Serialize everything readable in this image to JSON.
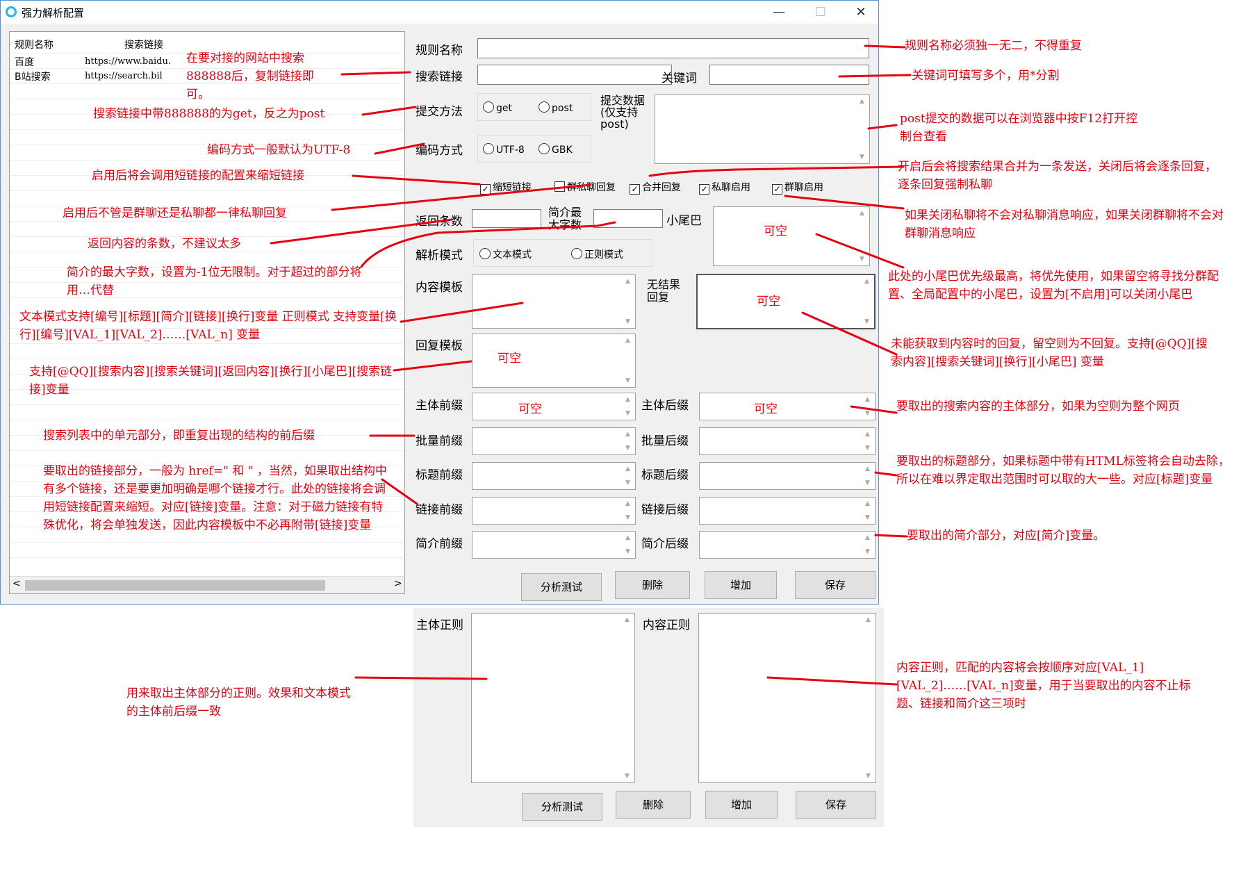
{
  "window": {
    "title": "强力解析配置",
    "minimize": "—",
    "maximize": "☐",
    "close": "✕"
  },
  "rules_list": {
    "headers": [
      "规则名称",
      "搜索链接"
    ],
    "rows": [
      {
        "name": "百度",
        "link": "https://www.baidu."
      },
      {
        "name": "B站搜索",
        "link": "https://search.bil"
      }
    ],
    "scroll_left": "<",
    "scroll_right": ">"
  },
  "form": {
    "rule_name_label": "规则名称",
    "search_link_label": "搜索链接",
    "keyword_label": "关键词",
    "submit_method_label": "提交方法",
    "submit_get": "get",
    "submit_post": "post",
    "submit_data_label": "提交数据(仅支持post)",
    "encoding_label": "编码方式",
    "enc_utf8": "UTF-8",
    "enc_gbk": "GBK",
    "checkboxes": [
      {
        "label": "缩短链接",
        "checked": true
      },
      {
        "label": "群私聊回复",
        "checked": false
      },
      {
        "label": "合并回复",
        "checked": true
      },
      {
        "label": "私聊启用",
        "checked": true
      },
      {
        "label": "群聊启用",
        "checked": true
      }
    ],
    "return_count_label": "返回条数",
    "summary_max_label": "简介最大字数",
    "tail_label": "小尾巴",
    "tail_placeholder": "可空",
    "parse_mode_label": "解析模式",
    "mode_text": "文本模式",
    "mode_regex": "正则模式",
    "content_tpl_label": "内容模板",
    "no_result_label": "无结果回复",
    "no_result_placeholder": "可空",
    "reply_tpl_label": "回复模板",
    "reply_tpl_placeholder": "可空",
    "body_prefix_label": "主体前缀",
    "body_prefix_placeholder": "可空",
    "body_suffix_label": "主体后缀",
    "body_suffix_placeholder": "可空",
    "batch_prefix_label": "批量前缀",
    "batch_suffix_label": "批量后缀",
    "title_prefix_label": "标题前缀",
    "title_suffix_label": "标题后缀",
    "link_prefix_label": "链接前缀",
    "link_suffix_label": "链接后缀",
    "summary_prefix_label": "简介前缀",
    "summary_suffix_label": "简介后缀",
    "body_regex_label": "主体正则",
    "content_regex_label": "内容正则"
  },
  "buttons": {
    "analyze": "分析测试",
    "delete": "删除",
    "add": "增加",
    "save": "保存"
  },
  "annotations": {
    "a1": "在要对接的网站中搜索888888后，复制链接即可。",
    "a2": "搜索链接中带888888的为get，反之为post",
    "a3": "编码方式一般默认为UTF-8",
    "a4": "启用后将会调用短链接的配置来缩短链接",
    "a5": "启用后不管是群聊还是私聊都一律私聊回复",
    "a6": "返回内容的条数，不建议太多",
    "a7": "简介的最大字数，设置为-1位无限制。对于超过的部分将用…代替",
    "a8": "文本模式支持[编号][标题][简介][链接][换行]变量   正则模式 支持变量[换行][编号][VAL_1][VAL_2]……[VAL_n] 变量",
    "a9": "支持[@QQ][搜索内容][搜索关键词][返回内容][换行][小尾巴][搜索链接]变量",
    "a10": "搜索列表中的单元部分，即重复出现的结构的前后缀",
    "a11": "要取出的链接部分，一般为 href=\" 和 \" ，当然，如果取出结构中有多个链接，还是要更加明确是哪个链接才行。此处的链接将会调用短链接配置来缩短。对应[链接]变量。注意：对于磁力链接有特殊优化，将会单独发送，因此内容模板中不必再附带[链接]变量",
    "a12": "用来取出主体部分的正则。效果和文本模式的主体前后缀一致",
    "r1": "规则名称必须独一无二，不得重复",
    "r2": "关键词可填写多个，用*分割",
    "r3": "post提交的数据可以在浏览器中按F12打开控制台查看",
    "r4": "开启后会将搜索结果合并为一条发送，关闭后将会逐条回复，逐条回复强制私聊",
    "r5": "如果关闭私聊将不会对私聊消息响应，如果关闭群聊将不会对群聊消息响应",
    "r6": "此处的小尾巴优先级最高，将优先使用，如果留空将寻找分群配置、全局配置中的小尾巴，设置为[不启用]可以关闭小尾巴",
    "r7": "未能获取到内容时的回复，留空则为不回复。支持[@QQ][搜索内容][搜索关键词][换行][小尾巴] 变量",
    "r8": "要取出的搜索内容的主体部分，如果为空则为整个网页",
    "r9": "要取出的标题部分，如果标题中带有HTML标签将会自动去除，所以在难以界定取出范围时可以取的大一些。对应[标题]变量",
    "r10": "要取出的简介部分，对应[简介]变量。",
    "r11": "内容正则，匹配的内容将会按顺序对应[VAL_1][VAL_2]……[VAL_n]变量，用于当要取出的内容不止标题、链接和简介这三项时"
  },
  "colors": {
    "annotation": "#e60012",
    "window_bg": "#f0f0f0",
    "window_border": "#5b8fd6",
    "radio_icon": "#29b6e6"
  }
}
